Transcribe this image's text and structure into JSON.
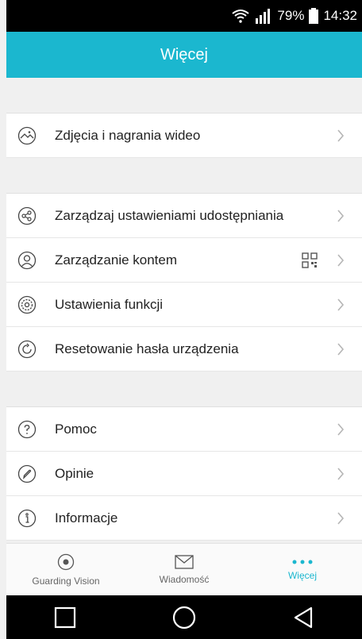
{
  "status_bar": {
    "battery": "79%",
    "time": "14:32"
  },
  "header": {
    "title": "Więcej"
  },
  "section1": [
    {
      "label": "Zdjęcia i nagrania wideo",
      "icon": "photo-icon"
    }
  ],
  "section2": [
    {
      "label": "Zarządzaj ustawieniami udostępniania",
      "icon": "share-icon"
    },
    {
      "label": "Zarządzanie kontem",
      "icon": "account-icon"
    },
    {
      "label": "Ustawienia funkcji",
      "icon": "settings-icon"
    },
    {
      "label": "Resetowanie hasła urządzenia",
      "icon": "reset-icon"
    }
  ],
  "section3": [
    {
      "label": "Pomoc",
      "icon": "help-icon"
    },
    {
      "label": "Opinie",
      "icon": "feedback-icon"
    },
    {
      "label": "Informacje",
      "icon": "info-icon"
    }
  ],
  "tabbar": {
    "tabs": [
      {
        "label": "Guarding Vision",
        "icon": "guarding-vision-icon"
      },
      {
        "label": "Wiadomość",
        "icon": "message-icon"
      },
      {
        "label": "Więcej",
        "icon": "more-icon"
      }
    ],
    "active_index": 2
  },
  "colors": {
    "accent": "#1bb7cf"
  }
}
